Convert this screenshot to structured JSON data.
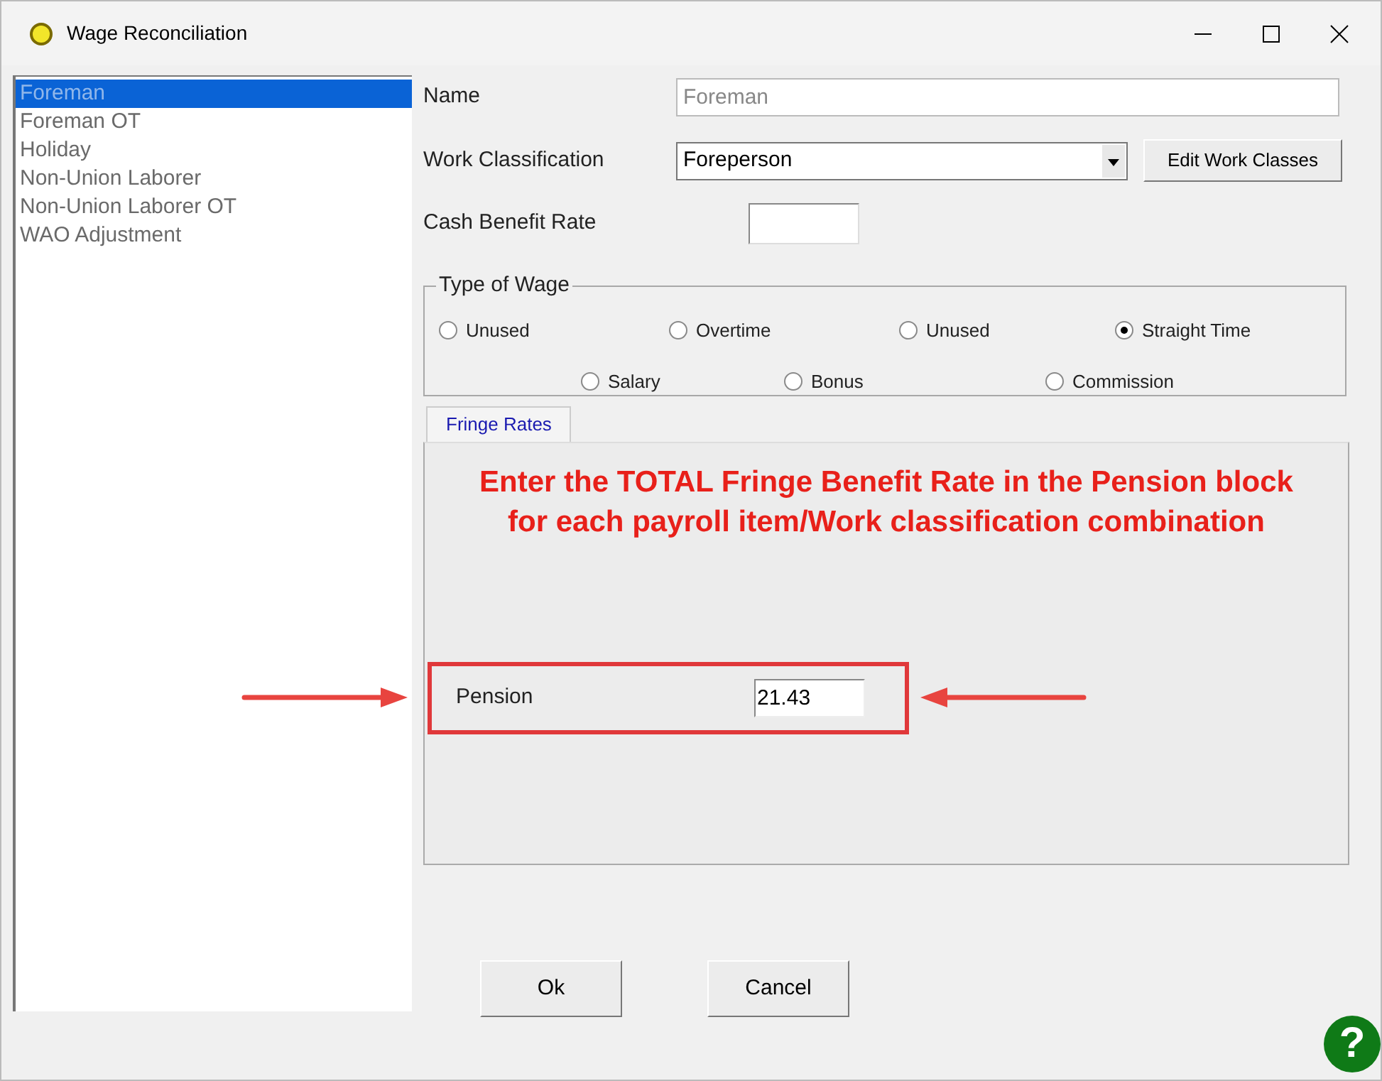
{
  "window": {
    "title": "Wage Reconciliation"
  },
  "payroll_items": [
    {
      "label": "Foreman",
      "selected": true
    },
    {
      "label": "Foreman OT",
      "selected": false
    },
    {
      "label": "Holiday",
      "selected": false
    },
    {
      "label": "Non-Union Laborer",
      "selected": false
    },
    {
      "label": "Non-Union Laborer OT",
      "selected": false
    },
    {
      "label": "WAO Adjustment",
      "selected": false
    }
  ],
  "name": {
    "label": "Name",
    "value": "Foreman",
    "disabled": true
  },
  "work_classification": {
    "label": "Work Classification",
    "value": "Foreperson",
    "button": "Edit Work Classes"
  },
  "cash_benefit_rate": {
    "label": "Cash Benefit Rate"
  },
  "type_of_wage": {
    "title": "Type of Wage",
    "options": [
      {
        "label": "Unused",
        "selected": false
      },
      {
        "label": "Overtime",
        "selected": false
      },
      {
        "label": "Unused",
        "selected": false
      },
      {
        "label": "Straight Time",
        "selected": true
      },
      {
        "label": "Salary",
        "selected": false
      },
      {
        "label": "Bonus",
        "selected": false
      },
      {
        "label": "Commission",
        "selected": false
      }
    ]
  },
  "tabs": [
    {
      "label": "Fringe Rates",
      "selected": true
    }
  ],
  "annotation": "Enter the TOTAL Fringe Benefit Rate in the Pension block for each payroll item/Work classification combination",
  "pension": {
    "label": "Pension",
    "value": "21.43"
  },
  "buttons": [
    "Ok",
    "Cancel"
  ],
  "help": "?"
}
